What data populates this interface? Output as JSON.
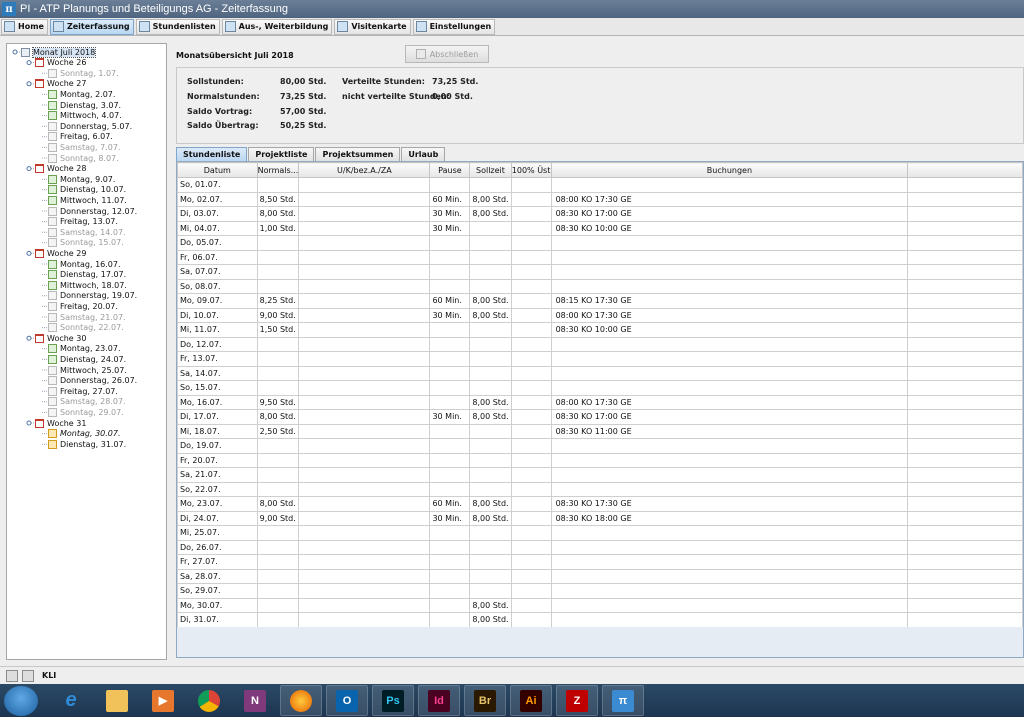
{
  "window": {
    "title": "PI - ATP Planungs und Beteiligungs AG - Zeiterfassung",
    "app_icon": "π"
  },
  "toolbar": [
    {
      "label": "Home",
      "icon": "home-icon",
      "active": false
    },
    {
      "label": "Zeiterfassung",
      "icon": "clock-icon",
      "active": true
    },
    {
      "label": "Stundenlisten",
      "icon": "list-icon",
      "active": false
    },
    {
      "label": "Aus-, Weiterbildung",
      "icon": "education-icon",
      "active": false
    },
    {
      "label": "Visitenkarte",
      "icon": "card-icon",
      "active": false
    },
    {
      "label": "Einstellungen",
      "icon": "settings-icon",
      "active": false
    }
  ],
  "tree": [
    {
      "label": "Monat Juli 2018",
      "level": 0,
      "kind": "month",
      "selected": true
    },
    {
      "label": "Woche 26",
      "level": 1,
      "kind": "week"
    },
    {
      "label": "Sonntag, 1.07.",
      "level": 2,
      "kind": "day",
      "weekend": true
    },
    {
      "label": "Woche 27",
      "level": 1,
      "kind": "week"
    },
    {
      "label": "Montag, 2.07.",
      "level": 2,
      "kind": "day"
    },
    {
      "label": "Dienstag, 3.07.",
      "level": 2,
      "kind": "day"
    },
    {
      "label": "Mittwoch, 4.07.",
      "level": 2,
      "kind": "day"
    },
    {
      "label": "Donnerstag, 5.07.",
      "level": 2,
      "kind": "day",
      "empty": true
    },
    {
      "label": "Freitag, 6.07.",
      "level": 2,
      "kind": "day",
      "empty": true
    },
    {
      "label": "Samstag, 7.07.",
      "level": 2,
      "kind": "day",
      "weekend": true
    },
    {
      "label": "Sonntag, 8.07.",
      "level": 2,
      "kind": "day",
      "weekend": true
    },
    {
      "label": "Woche 28",
      "level": 1,
      "kind": "week"
    },
    {
      "label": "Montag, 9.07.",
      "level": 2,
      "kind": "day"
    },
    {
      "label": "Dienstag, 10.07.",
      "level": 2,
      "kind": "day"
    },
    {
      "label": "Mittwoch, 11.07.",
      "level": 2,
      "kind": "day"
    },
    {
      "label": "Donnerstag, 12.07.",
      "level": 2,
      "kind": "day",
      "empty": true
    },
    {
      "label": "Freitag, 13.07.",
      "level": 2,
      "kind": "day",
      "empty": true
    },
    {
      "label": "Samstag, 14.07.",
      "level": 2,
      "kind": "day",
      "weekend": true
    },
    {
      "label": "Sonntag, 15.07.",
      "level": 2,
      "kind": "day",
      "weekend": true
    },
    {
      "label": "Woche 29",
      "level": 1,
      "kind": "week"
    },
    {
      "label": "Montag, 16.07.",
      "level": 2,
      "kind": "day"
    },
    {
      "label": "Dienstag, 17.07.",
      "level": 2,
      "kind": "day"
    },
    {
      "label": "Mittwoch, 18.07.",
      "level": 2,
      "kind": "day"
    },
    {
      "label": "Donnerstag, 19.07.",
      "level": 2,
      "kind": "day",
      "empty": true
    },
    {
      "label": "Freitag, 20.07.",
      "level": 2,
      "kind": "day",
      "empty": true
    },
    {
      "label": "Samstag, 21.07.",
      "level": 2,
      "kind": "day",
      "weekend": true
    },
    {
      "label": "Sonntag, 22.07.",
      "level": 2,
      "kind": "day",
      "weekend": true
    },
    {
      "label": "Woche 30",
      "level": 1,
      "kind": "week"
    },
    {
      "label": "Montag, 23.07.",
      "level": 2,
      "kind": "day"
    },
    {
      "label": "Dienstag, 24.07.",
      "level": 2,
      "kind": "day"
    },
    {
      "label": "Mittwoch, 25.07.",
      "level": 2,
      "kind": "day",
      "empty": true
    },
    {
      "label": "Donnerstag, 26.07.",
      "level": 2,
      "kind": "day",
      "empty": true
    },
    {
      "label": "Freitag, 27.07.",
      "level": 2,
      "kind": "day",
      "empty": true
    },
    {
      "label": "Samstag, 28.07.",
      "level": 2,
      "kind": "day",
      "weekend": true
    },
    {
      "label": "Sonntag, 29.07.",
      "level": 2,
      "kind": "day",
      "weekend": true
    },
    {
      "label": "Woche 31",
      "level": 1,
      "kind": "week"
    },
    {
      "label": "Montag, 30.07.",
      "level": 2,
      "kind": "day",
      "future": true,
      "italic": true
    },
    {
      "label": "Dienstag, 31.07.",
      "level": 2,
      "kind": "day",
      "future": true
    }
  ],
  "month": {
    "title": "Monatsübersicht Juli 2018",
    "close_button": "Abschließen",
    "summary_left": [
      {
        "label": "Sollstunden:",
        "value": "80,00 Std."
      },
      {
        "label": "Normalstunden:",
        "value": "73,25 Std."
      },
      {
        "label": "Saldo Vortrag:",
        "value": "57,00 Std."
      },
      {
        "label": "Saldo Übertrag:",
        "value": "50,25 Std."
      }
    ],
    "summary_right": [
      {
        "label": "Verteilte Stunden:",
        "value": "73,25 Std."
      },
      {
        "label": "nicht verteilte Stunden:",
        "value": "0,00 Std."
      }
    ]
  },
  "subtabs": [
    {
      "label": "Stundenliste",
      "active": true
    },
    {
      "label": "Projektliste",
      "active": false
    },
    {
      "label": "Projektsummen",
      "active": false
    },
    {
      "label": "Urlaub",
      "active": false
    }
  ],
  "table": {
    "columns": [
      "Datum",
      "Normals...",
      "U/K/bez.A./ZA",
      "Pause",
      "Sollzeit",
      "100% Üst",
      "Buchungen",
      ""
    ],
    "rows": [
      [
        "So, 01.07.",
        "",
        "",
        "",
        "",
        "",
        "",
        ""
      ],
      [
        "Mo, 02.07.",
        "8,50 Std.",
        "",
        "60 Min.",
        "8,00 Std.",
        "",
        "08:00 KO  17:30 GE",
        ""
      ],
      [
        "Di, 03.07.",
        "8,00 Std.",
        "",
        "30 Min.",
        "8,00 Std.",
        "",
        "08:30 KO  17:00 GE",
        ""
      ],
      [
        "Mi, 04.07.",
        "1,00 Std.",
        "",
        "30 Min.",
        "",
        "",
        "08:30 KO  10:00 GE",
        ""
      ],
      [
        "Do, 05.07.",
        "",
        "",
        "",
        "",
        "",
        "",
        ""
      ],
      [
        "Fr, 06.07.",
        "",
        "",
        "",
        "",
        "",
        "",
        ""
      ],
      [
        "Sa, 07.07.",
        "",
        "",
        "",
        "",
        "",
        "",
        ""
      ],
      [
        "So, 08.07.",
        "",
        "",
        "",
        "",
        "",
        "",
        ""
      ],
      [
        "Mo, 09.07.",
        "8,25 Std.",
        "",
        "60 Min.",
        "8,00 Std.",
        "",
        "08:15 KO  17:30 GE",
        ""
      ],
      [
        "Di, 10.07.",
        "9,00 Std.",
        "",
        "30 Min.",
        "8,00 Std.",
        "",
        "08:00 KO  17:30 GE",
        ""
      ],
      [
        "Mi, 11.07.",
        "1,50 Std.",
        "",
        "",
        "",
        "",
        "08:30 KO  10:00 GE",
        ""
      ],
      [
        "Do, 12.07.",
        "",
        "",
        "",
        "",
        "",
        "",
        ""
      ],
      [
        "Fr, 13.07.",
        "",
        "",
        "",
        "",
        "",
        "",
        ""
      ],
      [
        "Sa, 14.07.",
        "",
        "",
        "",
        "",
        "",
        "",
        ""
      ],
      [
        "So, 15.07.",
        "",
        "",
        "",
        "",
        "",
        "",
        ""
      ],
      [
        "Mo, 16.07.",
        "9,50 Std.",
        "",
        "",
        "8,00 Std.",
        "",
        "08:00 KO  17:30 GE",
        ""
      ],
      [
        "Di, 17.07.",
        "8,00 Std.",
        "",
        "30 Min.",
        "8,00 Std.",
        "",
        "08:30 KO  17:00 GE",
        ""
      ],
      [
        "Mi, 18.07.",
        "2,50 Std.",
        "",
        "",
        "",
        "",
        "08:30 KO  11:00 GE",
        ""
      ],
      [
        "Do, 19.07.",
        "",
        "",
        "",
        "",
        "",
        "",
        ""
      ],
      [
        "Fr, 20.07.",
        "",
        "",
        "",
        "",
        "",
        "",
        ""
      ],
      [
        "Sa, 21.07.",
        "",
        "",
        "",
        "",
        "",
        "",
        ""
      ],
      [
        "So, 22.07.",
        "",
        "",
        "",
        "",
        "",
        "",
        ""
      ],
      [
        "Mo, 23.07.",
        "8,00 Std.",
        "",
        "60 Min.",
        "8,00 Std.",
        "",
        "08:30 KO  17:30 GE",
        ""
      ],
      [
        "Di, 24.07.",
        "9,00 Std.",
        "",
        "30 Min.",
        "8,00 Std.",
        "",
        "08:30 KO  18:00 GE",
        ""
      ],
      [
        "Mi, 25.07.",
        "",
        "",
        "",
        "",
        "",
        "",
        ""
      ],
      [
        "Do, 26.07.",
        "",
        "",
        "",
        "",
        "",
        "",
        ""
      ],
      [
        "Fr, 27.07.",
        "",
        "",
        "",
        "",
        "",
        "",
        ""
      ],
      [
        "Sa, 28.07.",
        "",
        "",
        "",
        "",
        "",
        "",
        ""
      ],
      [
        "So, 29.07.",
        "",
        "",
        "",
        "",
        "",
        "",
        ""
      ],
      [
        "Mo, 30.07.",
        "",
        "",
        "",
        "8,00 Std.",
        "",
        "",
        ""
      ],
      [
        "Di, 31.07.",
        "",
        "",
        "",
        "8,00 Std.",
        "",
        "",
        ""
      ]
    ]
  },
  "statusbar": {
    "user": "KLI"
  },
  "taskbar": [
    {
      "name": "start-button"
    },
    {
      "name": "internet-explorer-icon",
      "glyph": "e",
      "color": "#2e8bd8",
      "bg": "transparent",
      "open": false
    },
    {
      "name": "file-explorer-icon",
      "glyph": "",
      "color": "#f2c25a",
      "bg": "#f2c25a",
      "open": false
    },
    {
      "name": "media-player-icon",
      "glyph": "▶",
      "color": "#ffffff",
      "bg": "#e8772e",
      "open": false
    },
    {
      "name": "chrome-icon",
      "glyph": "",
      "color": "#ffffff",
      "bg": "conic-gradient(#db4437 0 33%, #f4b400 0 66%, #0f9d58 0)",
      "open": false
    },
    {
      "name": "onenote-icon",
      "glyph": "N",
      "color": "#ffffff",
      "bg": "#80397b",
      "open": false
    },
    {
      "name": "firefox-icon",
      "glyph": "",
      "color": "#ffffff",
      "bg": "radial-gradient(circle, #ffcb3d, #e66000)",
      "open": true
    },
    {
      "name": "outlook-icon",
      "glyph": "O",
      "color": "#ffffff",
      "bg": "#0a64ad",
      "open": true
    },
    {
      "name": "photoshop-icon",
      "glyph": "Ps",
      "color": "#31c5f0",
      "bg": "#001d26",
      "open": true
    },
    {
      "name": "indesign-icon",
      "glyph": "Id",
      "color": "#ff3f94",
      "bg": "#49021f",
      "open": true
    },
    {
      "name": "bridge-icon",
      "glyph": "Br",
      "color": "#e8c56c",
      "bg": "#2a1900",
      "open": true
    },
    {
      "name": "illustrator-icon",
      "glyph": "Ai",
      "color": "#ff9a00",
      "bg": "#330000",
      "open": true
    },
    {
      "name": "filezilla-icon",
      "glyph": "Z",
      "color": "#ffffff",
      "bg": "#bf0000",
      "open": true
    },
    {
      "name": "pi-app-icon",
      "glyph": "π",
      "color": "#ffffff",
      "bg": "#3a8bd1",
      "open": true
    }
  ]
}
